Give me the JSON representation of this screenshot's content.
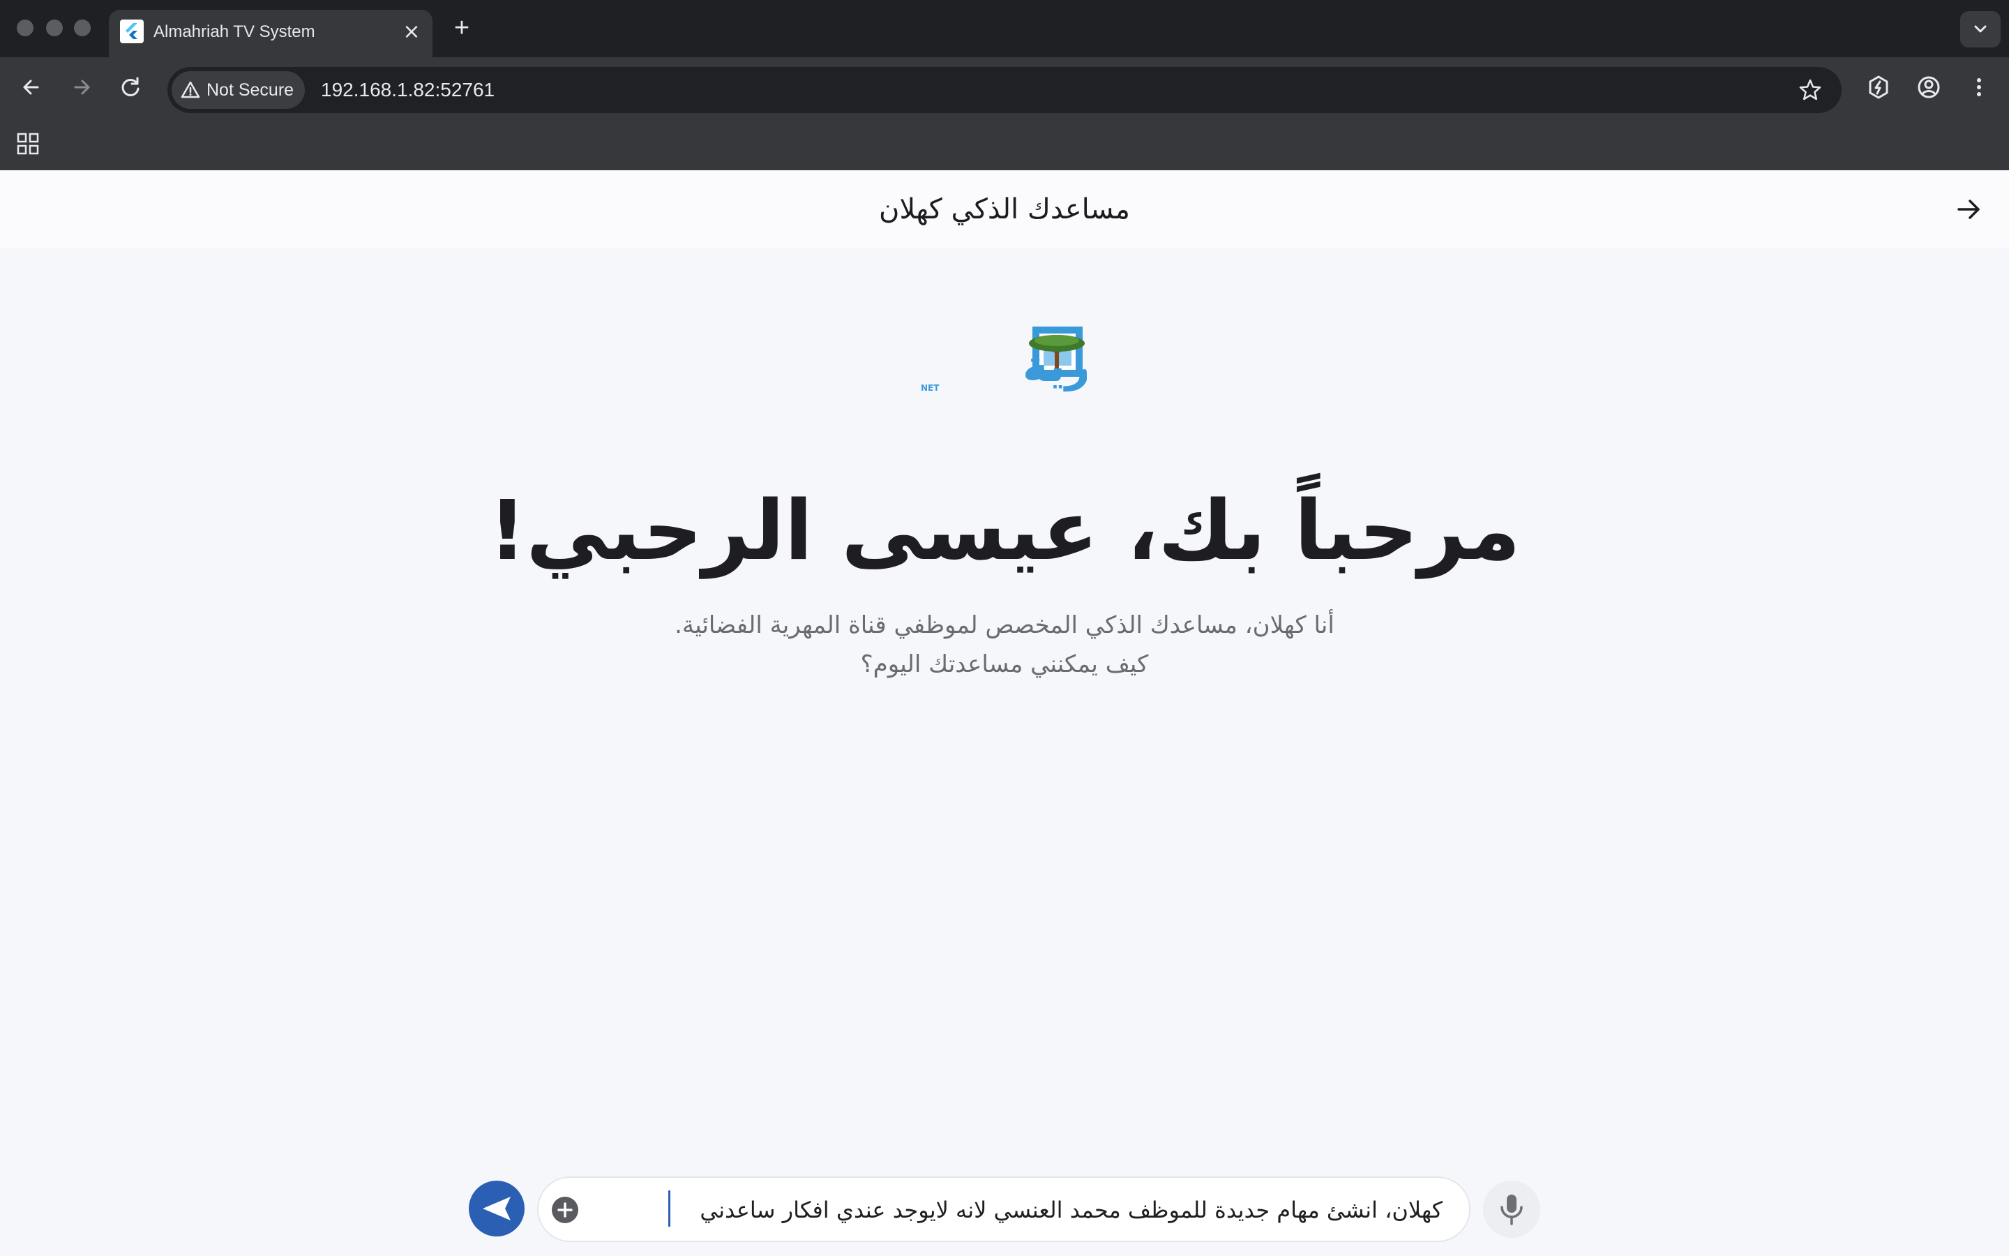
{
  "browser": {
    "tab": {
      "title": "Almahriah TV System"
    },
    "address_bar": {
      "security_label": "Not Secure",
      "url": "192.168.1.82:52761"
    }
  },
  "app": {
    "header_title": "مساعدك الذكي كهلان",
    "welcome": "مرحباً بك، عيسى الرحبي!",
    "subtitle_line1": "أنا كهلان، مساعدك الذكي المخصص لموظفي قناة المهرية الفضائية.",
    "subtitle_line2": "كيف يمكنني مساعدتك اليوم؟",
    "composer": {
      "value": "كهلان، انشئ مهام جديدة للموظف محمد العنسي لانه لايوجد عندي افكار ساعدني"
    },
    "logo": {
      "text": "المهرية",
      "suffix": "NET"
    }
  },
  "colors": {
    "accent": "#2b5fb4",
    "logo_blue": "#3a9ad9",
    "chrome_dark": "#1f2023",
    "chrome_toolbar": "#37383b",
    "page_bg": "#f6f7fb"
  },
  "icons": [
    "back-arrow-icon",
    "forward-arrow-icon",
    "reload-icon",
    "warning-icon",
    "star-icon",
    "extension-icon",
    "profile-icon",
    "more-vert-icon",
    "apps-grid-icon",
    "arrow-right-icon",
    "send-icon",
    "add-icon",
    "mic-icon"
  ]
}
